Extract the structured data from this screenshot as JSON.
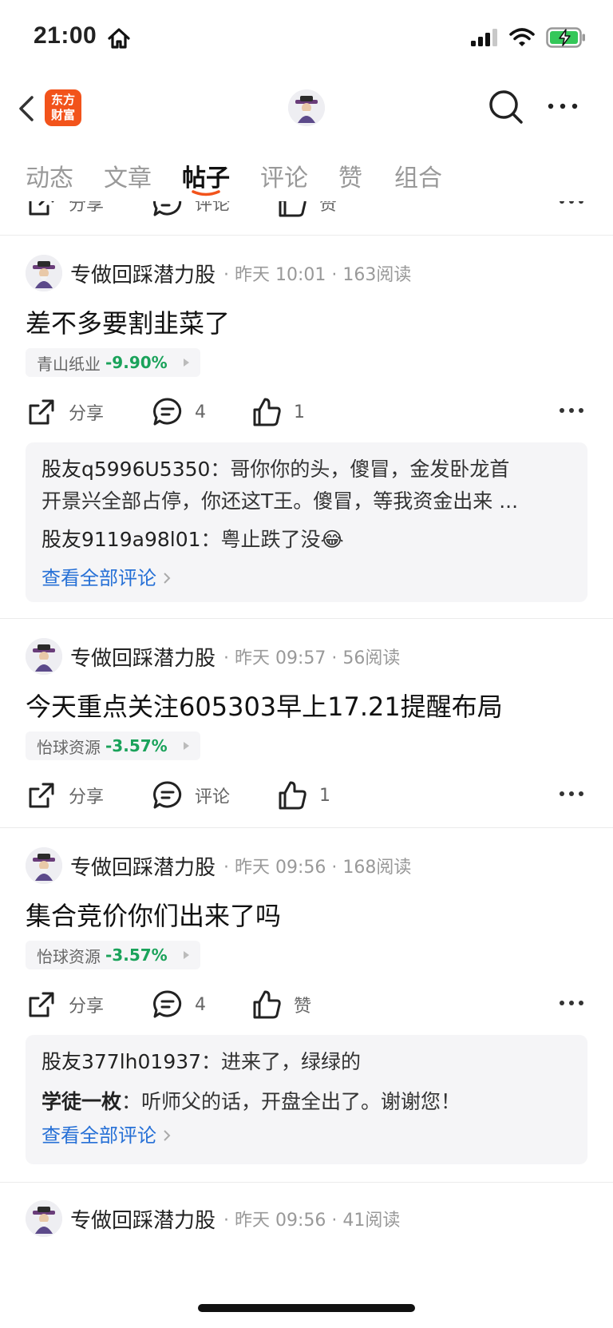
{
  "status_bar": {
    "time": "21:00"
  },
  "header": {
    "logo_line1": "东方",
    "logo_line2": "财富"
  },
  "tabs": [
    {
      "label": "动态"
    },
    {
      "label": "文章"
    },
    {
      "label": "帖子",
      "active": true
    },
    {
      "label": "评论"
    },
    {
      "label": "赞"
    },
    {
      "label": "组合"
    }
  ],
  "top_actions": {
    "share": "分享",
    "comment": "评论",
    "like": "赞"
  },
  "posts": [
    {
      "author": "专做回踩潜力股",
      "meta": "· 昨天 10:01 · 163阅读",
      "title": "差不多要割韭菜了",
      "stock": {
        "name": "青山纸业",
        "change": "-9.90%"
      },
      "actions": {
        "share": "分享",
        "comment": "4",
        "like": "1"
      },
      "comments": [
        {
          "user": "股友q5996U5350",
          "text": "：哥你你的头，傻冒，金发卧龙首",
          "text2": "开景兴全部占停，你还这T王。傻冒，等我资金出来 ..."
        },
        {
          "user": "股友9119a98l01",
          "text": "：粤止跌了没😂"
        }
      ],
      "see_all": "查看全部评论"
    },
    {
      "author": "专做回踩潜力股",
      "meta": "· 昨天 09:57 · 56阅读",
      "title": "今天重点关注605303早上17.21提醒布局",
      "stock": {
        "name": "怡球资源",
        "change": "-3.57%"
      },
      "actions": {
        "share": "分享",
        "comment": "评论",
        "like": "1"
      }
    },
    {
      "author": "专做回踩潜力股",
      "meta": "· 昨天 09:56 · 168阅读",
      "title": "集合竞价你们出来了吗",
      "stock": {
        "name": "怡球资源",
        "change": "-3.57%"
      },
      "actions": {
        "share": "分享",
        "comment": "4",
        "like": "赞"
      },
      "comments": [
        {
          "user": "股友377lh01937",
          "text": "：进来了，绿绿的"
        },
        {
          "user": "学徒一枚",
          "text": "：听师父的话，开盘全出了。谢谢您！"
        }
      ],
      "see_all": "查看全部评论"
    },
    {
      "author": "专做回踩潜力股",
      "meta": "· 昨天 09:56 · 41阅读"
    }
  ],
  "colors": {
    "accent_orange": "#f2531b",
    "link_blue": "#2670d6",
    "down_green": "#1aa25a"
  },
  "icons": [
    "home-icon",
    "signal-icon",
    "wifi-icon",
    "battery-icon",
    "back-icon",
    "search-icon",
    "more-icon",
    "share-icon",
    "comment-icon",
    "like-icon"
  ]
}
